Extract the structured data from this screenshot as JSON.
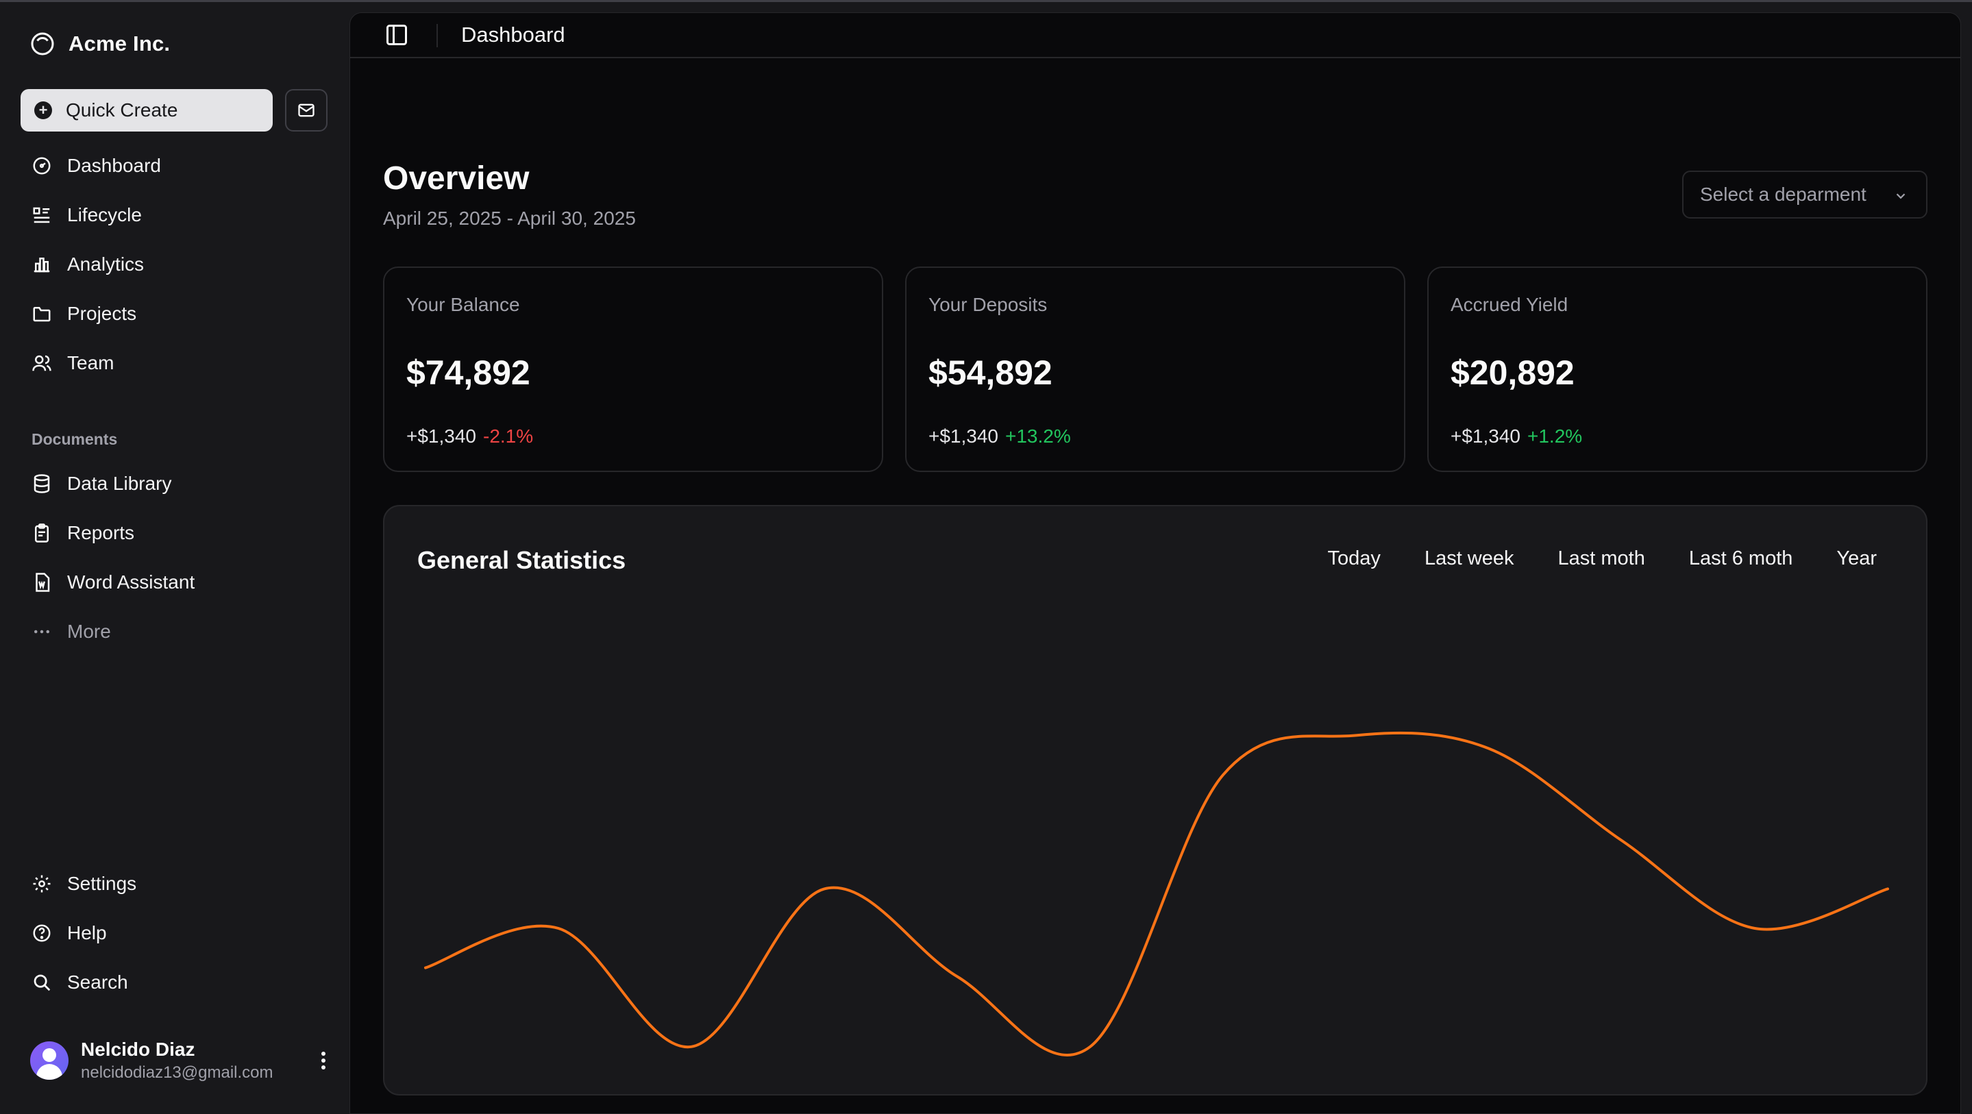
{
  "brand": {
    "name": "Acme Inc.",
    "icon": "circle-logo-icon"
  },
  "sidebar": {
    "quick_create": "Quick Create",
    "mail_icon": "mail-icon",
    "nav": [
      {
        "label": "Dashboard",
        "icon": "gauge-icon"
      },
      {
        "label": "Lifecycle",
        "icon": "list-icon"
      },
      {
        "label": "Analytics",
        "icon": "bar-chart-icon"
      },
      {
        "label": "Projects",
        "icon": "folder-icon"
      },
      {
        "label": "Team",
        "icon": "users-icon"
      }
    ],
    "documents_label": "Documents",
    "documents": [
      {
        "label": "Data Library",
        "icon": "database-icon"
      },
      {
        "label": "Reports",
        "icon": "clipboard-icon"
      },
      {
        "label": "Word Assistant",
        "icon": "file-word-icon"
      },
      {
        "label": "More",
        "icon": "dots-icon"
      }
    ],
    "footer": [
      {
        "label": "Settings",
        "icon": "gear-icon"
      },
      {
        "label": "Help",
        "icon": "help-circle-icon"
      },
      {
        "label": "Search",
        "icon": "search-icon"
      }
    ],
    "user": {
      "name": "Nelcido Diaz",
      "email": "nelcidodiaz13@gmail.com"
    }
  },
  "topbar": {
    "title": "Dashboard"
  },
  "overview": {
    "title": "Overview",
    "range": "April 25, 2025 - April 30, 2025",
    "select_placeholder": "Select a deparment"
  },
  "cards": [
    {
      "label": "Your Balance",
      "value": "$74,892",
      "delta": "+$1,340",
      "change": "-2.1%",
      "trend": "negative"
    },
    {
      "label": "Your Deposits",
      "value": "$54,892",
      "delta": "+$1,340",
      "change": "+13.2%",
      "trend": "positive"
    },
    {
      "label": "Accrued Yield",
      "value": "$20,892",
      "delta": "+$1,340",
      "change": "+1.2%",
      "trend": "positive"
    }
  ],
  "stats": {
    "title": "General Statistics",
    "tabs": [
      "Today",
      "Last week",
      "Last moth",
      "Last 6 moth",
      "Year"
    ]
  },
  "colors": {
    "line": "#f97316",
    "negative": "#ef4444",
    "positive": "#22c55e"
  },
  "chart_data": {
    "type": "line",
    "title": "General Statistics",
    "series": [
      {
        "values": [
          26,
          35,
          8,
          44,
          24,
          8,
          70,
          79,
          76,
          55,
          35,
          44
        ]
      }
    ],
    "ylim": [
      0,
      100
    ],
    "grid": false
  }
}
